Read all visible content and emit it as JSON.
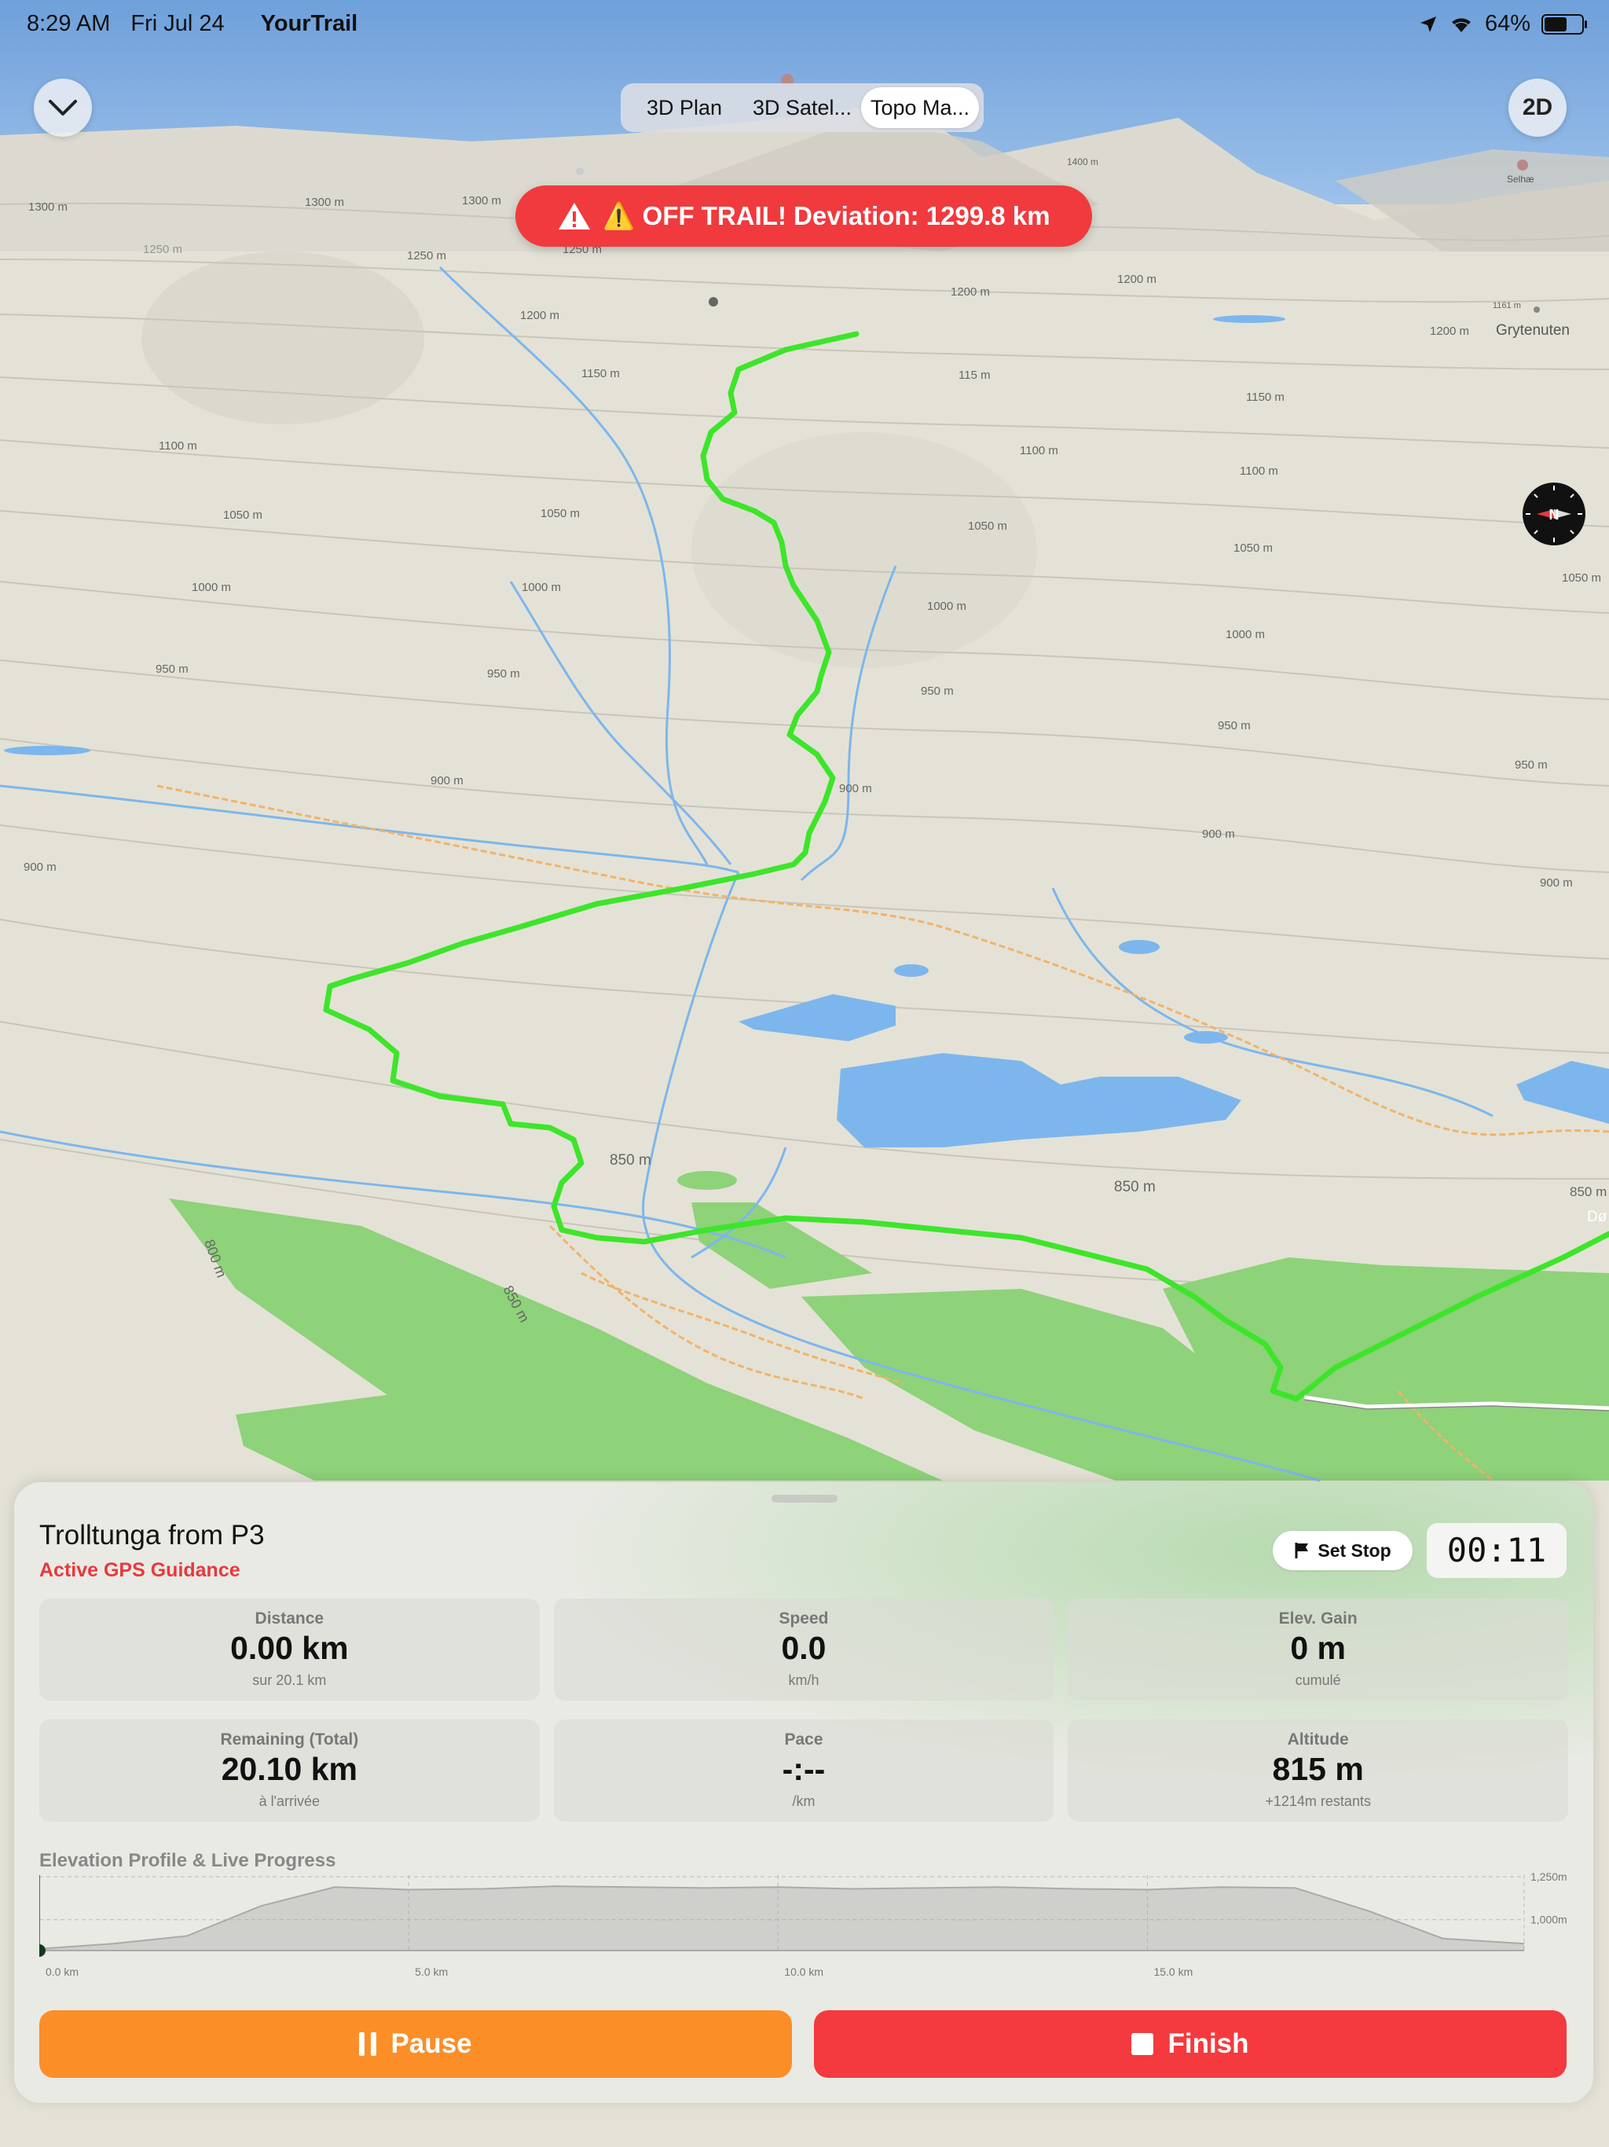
{
  "status_bar": {
    "time": "8:29 AM",
    "date": "Fri Jul 24",
    "app_name": "YourTrail",
    "battery": "64%",
    "battery_level": 0.64
  },
  "map_controls": {
    "collapse_icon": "chevron-down-icon",
    "view_2d_label": "2D",
    "segments": [
      "3D Plan",
      "3D Satel...",
      "Topo Ma..."
    ],
    "active_segment": 2
  },
  "alert": {
    "text": "⚠️ OFF TRAIL! Deviation: 1299.8 km",
    "color": "#f03a3e"
  },
  "map_labels": {
    "contours": [
      "1300 m",
      "1300 m",
      "1300 m",
      "1250 m",
      "1250 m",
      "1250 m",
      "1200 m",
      "1200 m",
      "1200 m",
      "1200 m",
      "1150 m",
      "1150 m",
      "115 m",
      "1100 m",
      "1100 m",
      "1100 m",
      "1050 m",
      "1050 m",
      "1050 m",
      "1050 m",
      "1050 m",
      "1000 m",
      "1000 m",
      "1000 m",
      "1000 m",
      "950 m",
      "950 m",
      "950 m",
      "950 m",
      "950 m",
      "900 m",
      "900 m",
      "900 m",
      "900 m",
      "900 m",
      "850 m",
      "850 m",
      "850 m",
      "850 m",
      "800 m",
      "1400 m",
      "1161 m"
    ],
    "places": [
      "Grytenuten",
      "Selhæ",
      "Dø"
    ]
  },
  "route_colors": {
    "trail": "#3de52a",
    "water": "#7db6ec",
    "forest": "#8ed27a",
    "path": "#f1b36a"
  },
  "panel": {
    "route_name": "Trolltunga from P3",
    "status": "Active GPS Guidance",
    "set_stop_label": "Set Stop",
    "timer": "00:11",
    "stats": [
      {
        "label": "Distance",
        "value": "0.00 km",
        "sub": "sur 20.1 km"
      },
      {
        "label": "Speed",
        "value": "0.0",
        "sub": "km/h"
      },
      {
        "label": "Elev. Gain",
        "value": "0 m",
        "sub": "cumulé"
      },
      {
        "label": "Remaining (Total)",
        "value": "20.10 km",
        "sub": "à l'arrivée"
      },
      {
        "label": "Pace",
        "value": "-:--",
        "sub": "/km"
      },
      {
        "label": "Altitude",
        "value": "815 m",
        "sub": "+1214m restants"
      }
    ],
    "elevation_title": "Elevation Profile & Live Progress",
    "pause_label": "Pause",
    "finish_label": "Finish"
  },
  "chart_data": {
    "type": "area",
    "title": "Elevation Profile & Live Progress",
    "x_unit": "km",
    "x_ticks": [
      "0.0 km",
      "5.0 km",
      "10.0 km",
      "15.0 km"
    ],
    "y_ticks": [
      "1,250m",
      "1,000m"
    ],
    "xlim": [
      0,
      20.1
    ],
    "ylim": [
      820,
      1260
    ],
    "x": [
      0,
      1,
      2,
      3,
      4,
      5,
      6,
      7,
      8,
      9,
      10,
      11,
      12,
      13,
      14,
      15,
      16,
      17,
      18,
      19,
      20.1
    ],
    "y": [
      830,
      860,
      905,
      1080,
      1190,
      1175,
      1180,
      1195,
      1190,
      1185,
      1190,
      1180,
      1185,
      1190,
      1180,
      1175,
      1190,
      1185,
      1050,
      890,
      860
    ],
    "current_x": 0
  }
}
